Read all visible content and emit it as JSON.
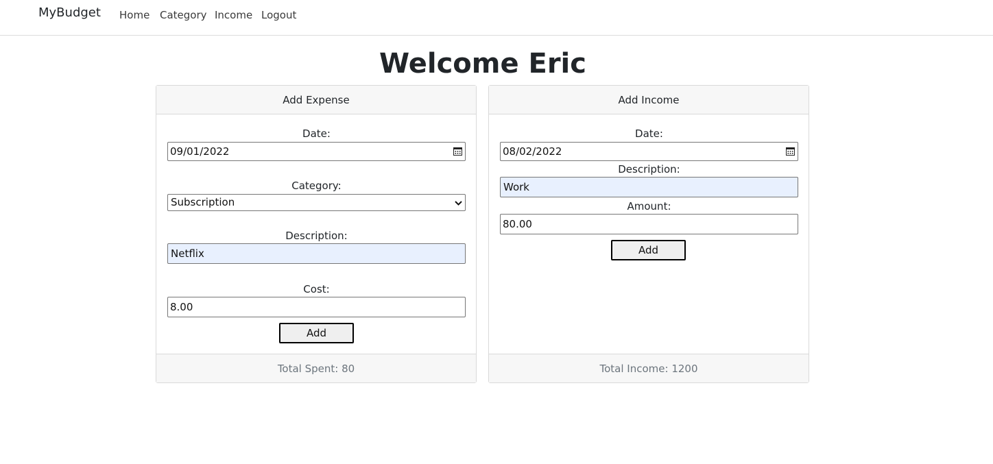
{
  "navbar": {
    "brand": "MyBudget",
    "links": [
      "Home",
      "Category",
      "Income",
      "Logout"
    ]
  },
  "page_title": "Welcome Eric",
  "expense_card": {
    "header": "Add Expense",
    "date_label": "Date:",
    "date_value": "09/01/2022",
    "category_label": "Category:",
    "category_value": "Subscription",
    "description_label": "Description:",
    "description_value": "Netflix",
    "cost_label": "Cost:",
    "cost_value": "8.00",
    "add_button": "Add",
    "footer": "Total Spent: 80"
  },
  "income_card": {
    "header": "Add Income",
    "date_label": "Date:",
    "date_value": "08/02/2022",
    "description_label": "Description:",
    "description_value": "Work",
    "amount_label": "Amount:",
    "amount_value": "80.00",
    "add_button": "Add",
    "footer": "Total Income: 1200"
  },
  "icons": {
    "date_picker": "calendar-icon",
    "select_arrow": "chevron-down-icon"
  },
  "colors": {
    "autofill_background": "#e8f0fe",
    "card_header_background": "#f7f7f7",
    "footer_text": "#6c757d"
  }
}
